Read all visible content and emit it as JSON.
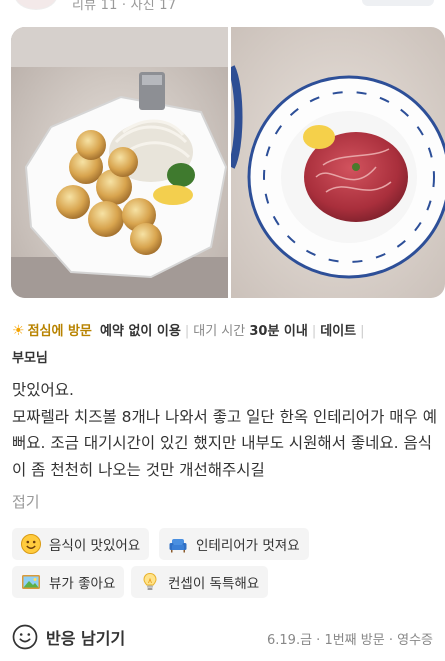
{
  "header": {
    "meta": "리뷰 11 · 사진 17"
  },
  "photos": [
    {
      "icon": "food-photo-fried-cheese-balls"
    },
    {
      "icon": "food-photo-beef-dish"
    }
  ],
  "tags": {
    "visit": "점심에 방문",
    "reservation": "예약 없이 이용",
    "wait_label": "대기 시간",
    "wait_value": "30분 이내",
    "purpose": "데이트",
    "companion": "부모님"
  },
  "review": {
    "text": "맛있어요.\n모짜렐라 치즈볼 8개나 나와서 좋고 일단 한옥 인테리어가 매우 예뻐요. 조금 대기시간이 있긴 했지만 내부도 시원해서 좋네요. 음식이 좀 천천히 나오는 것만 개선해주시길",
    "collapse": "접기"
  },
  "keywords": [
    {
      "label": "음식이 맛있어요",
      "icon": "smiley-icon"
    },
    {
      "label": "인테리어가 멋져요",
      "icon": "sofa-icon"
    },
    {
      "label": "뷰가 좋아요",
      "icon": "landscape-icon"
    },
    {
      "label": "컨셉이 독특해요",
      "icon": "lightbulb-icon"
    }
  ],
  "footer": {
    "react_label": "반응 남기기",
    "date": "6.19.금",
    "visit_count": "1번째 방문",
    "verify": "영수증"
  }
}
